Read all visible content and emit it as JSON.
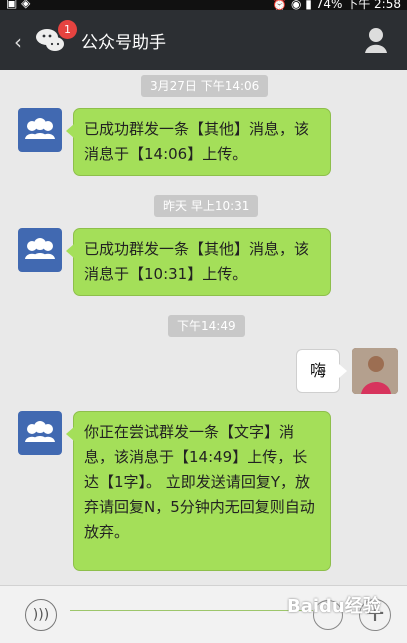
{
  "status": {
    "battery": "74%",
    "time": "下午 2:58"
  },
  "header": {
    "title": "公众号助手",
    "unread": "1"
  },
  "messages": {
    "t1": "3月27日 下午14:06",
    "m1": "已成功群发一条【其他】消息，该消息于【14:06】上传。",
    "t2": "昨天 早上10:31",
    "m2": "已成功群发一条【其他】消息，该消息于【10:31】上传。",
    "t3": "下午14:49",
    "sent": "嗨",
    "m3": "你正在尝试群发一条【文字】消息，该消息于【14:49】上传，长达【1字】。 立即发送请回复Y，放弃请回复N，5分钟内无回复则自动放弃。"
  },
  "watermark": "Baidu经验"
}
